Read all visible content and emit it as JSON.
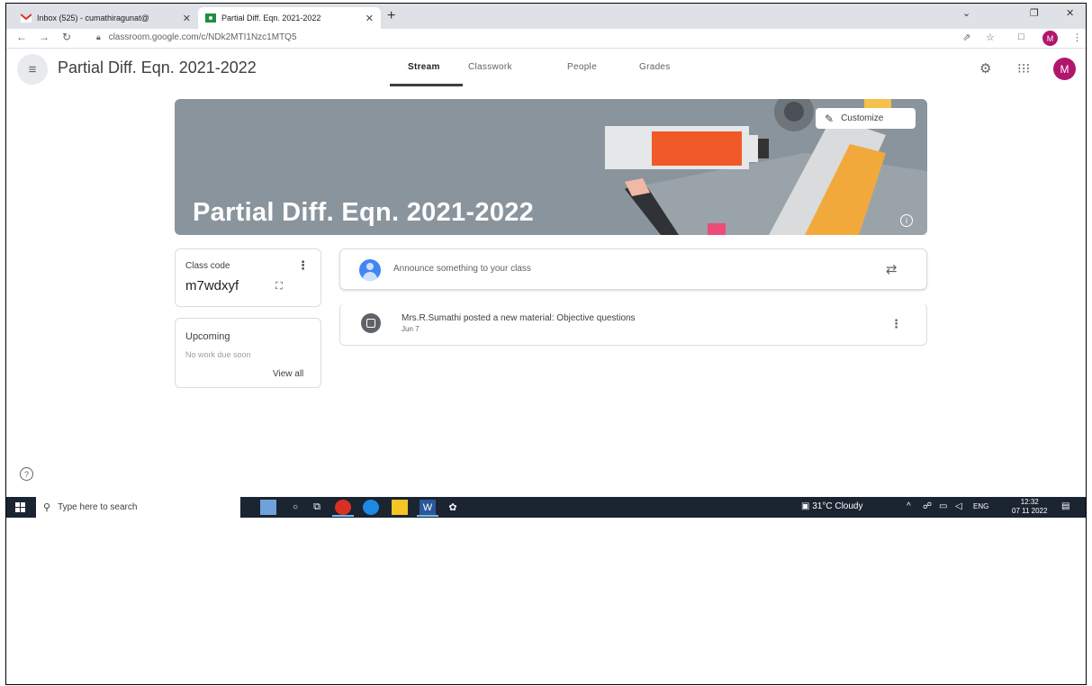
{
  "browser": {
    "tabs": [
      {
        "label": "Inbox (525) - cumathiragunat@",
        "icon": "gmail-icon"
      },
      {
        "label": "Partial Diff. Eqn. 2021-2022",
        "icon": "classroom-icon"
      }
    ],
    "url": "classroom.google.com/c/NDk2MTI1Nzc1MTQ5",
    "profile_initial": "M"
  },
  "header": {
    "course_title": "Partial Diff. Eqn. 2021-2022",
    "nav_tabs": [
      "Stream",
      "Classwork",
      "People",
      "Grades"
    ],
    "active_tab": "Stream",
    "avatar_initial": "M"
  },
  "banner": {
    "title": "Partial Diff. Eqn. 2021-2022",
    "customize_label": "Customize"
  },
  "class_code": {
    "label": "Class code",
    "code": "m7wdxyf"
  },
  "upcoming": {
    "title": "Upcoming",
    "status": "No work due soon",
    "view_all": "View all"
  },
  "announce": {
    "placeholder": "Announce something to your class"
  },
  "posts": [
    {
      "message": "Mrs.R.Sumathi posted a new material: Objective questions",
      "date": "Jun 7"
    }
  ],
  "taskbar": {
    "search_placeholder": "Type here to search",
    "weather": "31°C  Cloudy",
    "language": "ENG",
    "time": "12:32",
    "date": "07 11 2022"
  },
  "colors": {
    "accent_avatar": "#b0166c",
    "banner_bg": "#8a949c",
    "taskbar_bg": "#1b2431",
    "active_tab_underline": "#3c4043"
  }
}
